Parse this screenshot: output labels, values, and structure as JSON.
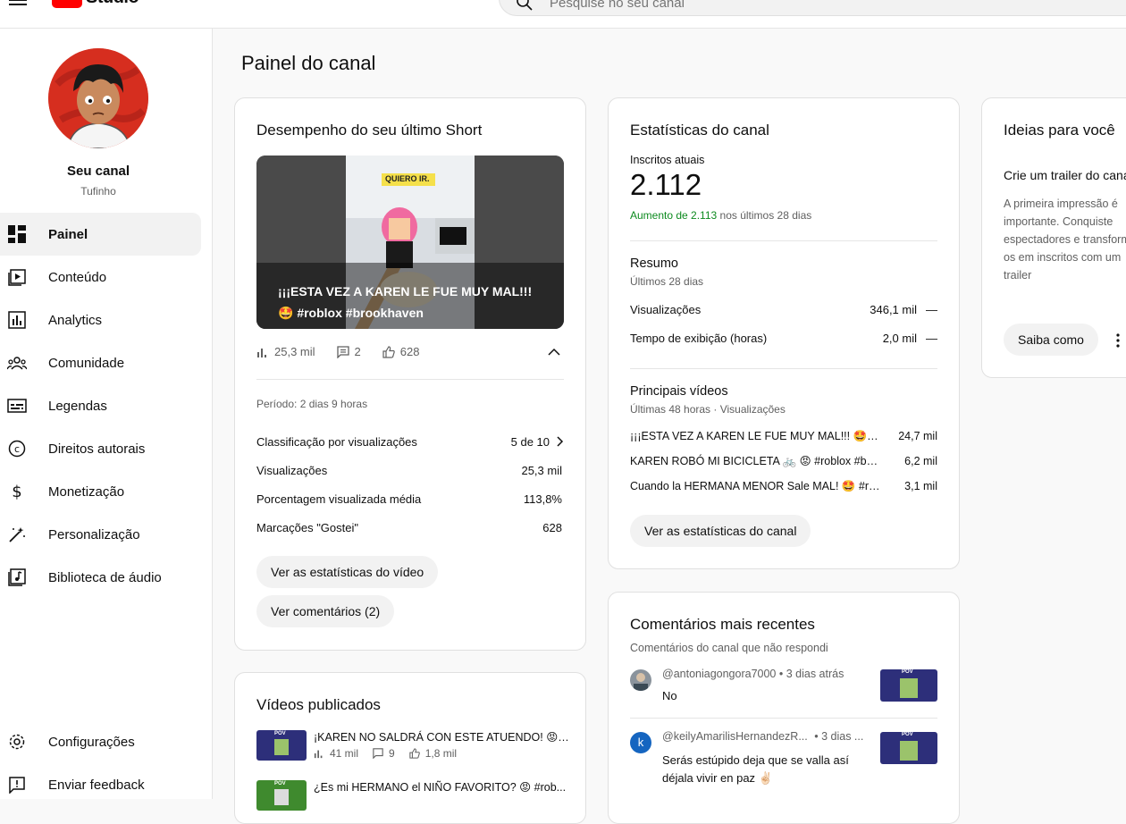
{
  "app": {
    "logo_text": "Studio"
  },
  "search": {
    "placeholder": "Pesquise no seu canal"
  },
  "channel": {
    "name": "Seu canal",
    "handle": "Tufinho"
  },
  "nav": {
    "items": [
      {
        "label": "Painel",
        "icon": "dashboard-icon",
        "active": true
      },
      {
        "label": "Conteúdo",
        "icon": "content-icon"
      },
      {
        "label": "Analytics",
        "icon": "analytics-icon"
      },
      {
        "label": "Comunidade",
        "icon": "community-icon"
      },
      {
        "label": "Legendas",
        "icon": "subtitles-icon"
      },
      {
        "label": "Direitos autorais",
        "icon": "copyright-icon"
      },
      {
        "label": "Monetização",
        "icon": "monetization-icon"
      },
      {
        "label": "Personalização",
        "icon": "customization-icon"
      },
      {
        "label": "Biblioteca de áudio",
        "icon": "audio-library-icon"
      }
    ],
    "bottom": [
      {
        "label": "Configurações",
        "icon": "settings-icon"
      },
      {
        "label": "Enviar feedback",
        "icon": "feedback-icon"
      }
    ]
  },
  "page": {
    "title": "Painel do canal"
  },
  "last_short": {
    "title": "Desempenho do seu último Short",
    "thumb_tag": "QUIERO IR.",
    "video_title": "¡¡¡ESTA VEZ A KAREN LE FUE MUY MAL!!!",
    "video_hashtags": "🤩 #roblox #brookhaven",
    "views": "25,3 mil",
    "comments": "2",
    "likes": "628",
    "period": "Período: 2 dias 9 horas",
    "rows": [
      {
        "label": "Classificação por visualizações",
        "value": "5 de 10"
      },
      {
        "label": "Visualizações",
        "value": "25,3 mil"
      },
      {
        "label": "Porcentagem visualizada média",
        "value": "113,8%"
      },
      {
        "label": "Marcações \"Gostei\"",
        "value": "628"
      }
    ],
    "btn_stats": "Ver as estatísticas do vídeo",
    "btn_comments": "Ver comentários (2)"
  },
  "published": {
    "title": "Vídeos publicados",
    "videos": [
      {
        "title": "¡KAREN NO SALDRÁ CON ESTE ATUENDO! 😡 ...",
        "views": "41 mil",
        "comments": "9",
        "likes": "1,8 mil",
        "thumb_label": "POV"
      },
      {
        "title": "¿Es mi HERMANO el NIÑO FAVORITO? 😡 #rob...",
        "views": "",
        "comments": "",
        "likes": "",
        "thumb_label": "POV"
      }
    ]
  },
  "channel_stats": {
    "title": "Estatísticas do canal",
    "subs_label": "Inscritos atuais",
    "subs_value": "2.112",
    "subs_change": "Aumento de 2.113",
    "subs_change_suffix": "nos últimos 28 dias",
    "summary_title": "Resumo",
    "summary_sub": "Últimos 28 dias",
    "summary_rows": [
      {
        "label": "Visualizações",
        "value": "346,1 mil",
        "trend": "—"
      },
      {
        "label": "Tempo de exibição (horas)",
        "value": "2,0 mil",
        "trend": "—"
      }
    ],
    "top_title": "Principais vídeos",
    "top_sub": "Últimas 48 horas · Visualizações",
    "top_videos": [
      {
        "title": "¡¡¡ESTA VEZ A KAREN LE FUE MUY MAL!!! 🤩 #r...",
        "value": "24,7 mil"
      },
      {
        "title": "KAREN ROBÓ MI BICICLETA 🚲 😡 #roblox #bro...",
        "value": "6,2 mil"
      },
      {
        "title": "Cuando la HERMANA MENOR Sale MAL! 🤩 #ro...",
        "value": "3,1 mil"
      }
    ],
    "btn": "Ver as estatísticas do canal"
  },
  "comments": {
    "title": "Comentários mais recentes",
    "sub": "Comentários do canal que não respondi",
    "items": [
      {
        "author": "@antoniagongora7000",
        "time": "• 3 dias atrás",
        "text": "No",
        "avatar_letter": "",
        "thumb_label": "POV"
      },
      {
        "author": "@keilyAmarilisHernandezR...",
        "time": "• 3 dias ...",
        "text": "Serás estúpido deja que se valla así déjala vivir en paz ✌🏻",
        "avatar_letter": "k",
        "thumb_label": "POV"
      }
    ]
  },
  "ideas": {
    "title": "Ideias para você",
    "subtitle": "Crie um trailer do canal",
    "body": "A primeira impressão é importante. Conquiste espectadores e transforme-os em inscritos com um trailer",
    "btn": "Saiba como"
  },
  "colors": {
    "accent_red": "#ff0000",
    "green": "#0d8a1f",
    "border": "#e0e0e0"
  }
}
